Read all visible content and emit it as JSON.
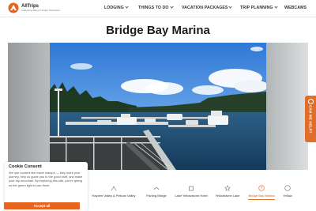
{
  "header": {
    "brand": "AllTrips",
    "tagline": "Celebrating Valleys & Greater Destinations",
    "nav": [
      {
        "label": "LODGING"
      },
      {
        "label": "THINGS TO DO"
      },
      {
        "label": "VACATION PACKAGES"
      },
      {
        "label": "TRIP PLANNING"
      },
      {
        "label": "WEBCAMS"
      }
    ]
  },
  "page": {
    "title": "Bridge Bay Marina"
  },
  "thumbnails": [
    {
      "label": "Hayden Valley & Pelican Valley",
      "icon": "trail-icon",
      "active": false
    },
    {
      "label": "Fishing Bridge",
      "icon": "bridge-icon",
      "active": false
    },
    {
      "label": "Lake Yellowstone Hotel",
      "icon": "hotel-icon",
      "active": false
    },
    {
      "label": "Yellowstone Lake",
      "icon": "star-icon",
      "active": false
    },
    {
      "label": "Bridge Bay Marina",
      "icon": "compass-icon",
      "active": true
    },
    {
      "label": "Yellow",
      "icon": "more-icon",
      "active": false
    }
  ],
  "cookie": {
    "title": "Cookie Consent",
    "text": "We use cookies like travel stamps — they mark your journey, help us guide you to the good stuff, and make your trip smoother. By exploring this site, you're giving us the green light to use them.",
    "button": "Accept all"
  },
  "help": {
    "label": "CAN WE HELP?"
  },
  "colors": {
    "accent": "#e8651f",
    "text": "#1d1d1d"
  }
}
